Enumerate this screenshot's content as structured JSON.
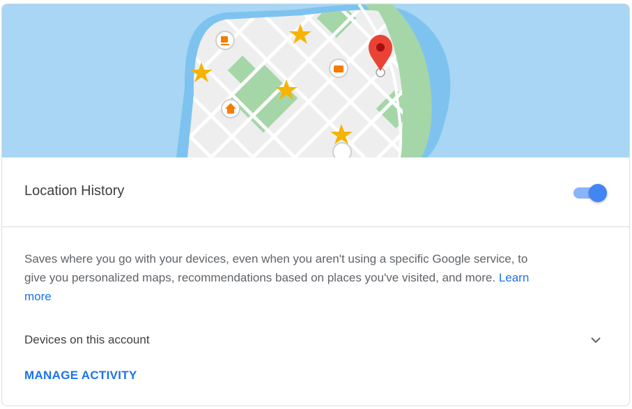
{
  "hero": {
    "image": "location-map-illustration"
  },
  "location_history": {
    "title": "Location History",
    "toggle_state": "on",
    "accent_color": "#4285f4"
  },
  "description": {
    "text": "Saves where you go with your devices, even when you aren't using a specific Google service, to give you personalized maps, recommendations based on places you've visited, and more.",
    "learn_more": "Learn more"
  },
  "devices": {
    "label": "Devices on this account",
    "icon": "chevron-down-icon"
  },
  "manage_activity": {
    "label": "MANAGE ACTIVITY"
  }
}
